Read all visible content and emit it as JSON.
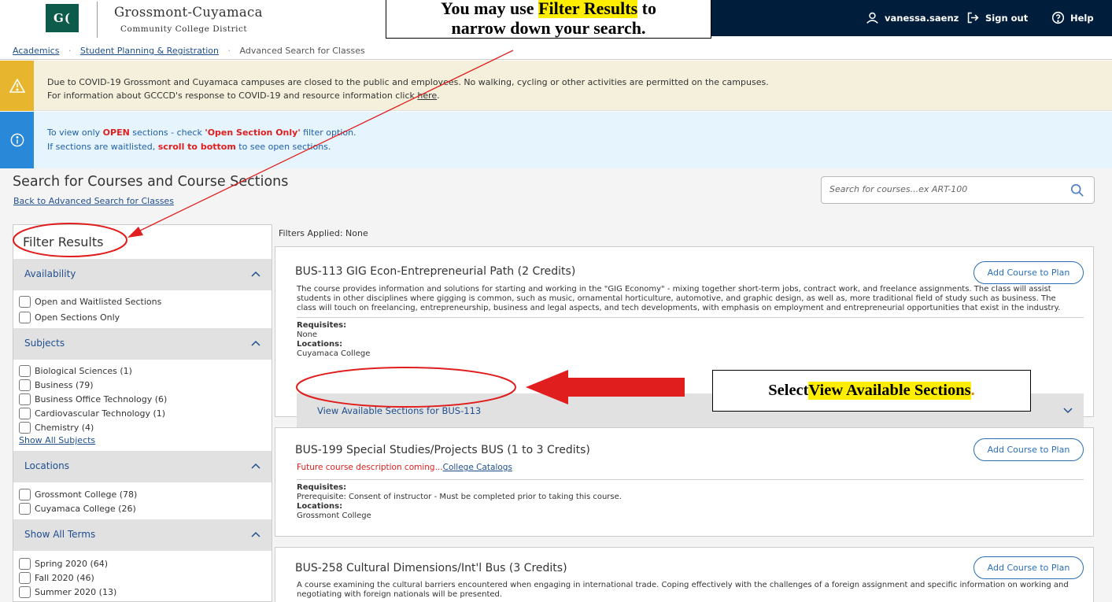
{
  "header": {
    "logo_mark": "G(",
    "logo_line1": "Grossmont-Cuyamaca",
    "logo_line2": "Community College District",
    "user": "vanessa.saenz",
    "sign_out": "Sign out",
    "help": "Help",
    "nav_color": "#001e3c"
  },
  "callout_top": {
    "line1_pre": "You may use ",
    "line1_hl": "Filter Results",
    "line1_post": " to",
    "line2": "narrow down your search."
  },
  "breadcrumbs": [
    "Academics",
    "Student Planning & Registration",
    "Advanced Search for Classes"
  ],
  "warning": {
    "line1": "Due to COVID-19 Grossmont and Cuyamaca campuses are closed to the public and employees. No walking, cycling or other activities are permitted on the campuses.",
    "line2_pre": "For information about GCCCD's response to COVID-19 and resource information click ",
    "line2_link": "here",
    "line2_post": ".",
    "accent": "#e8b52e"
  },
  "info": {
    "l1a": "To view only ",
    "l1b": "OPEN",
    "l1c": " sections - check ",
    "l1d": "'Open Section Only'",
    "l1e": " filter option.",
    "l2a": "If sections are waitlisted, ",
    "l2b": "scroll to bottom",
    "l2c": " to see open sections.",
    "accent": "#2a88d8"
  },
  "search": {
    "title": "Search for Courses and Course Sections",
    "back_link": "Back to Advanced Search for Classes",
    "placeholder": "Search for courses...ex ART-100"
  },
  "filter": {
    "title": "Filter Results",
    "availability": {
      "label": "Availability",
      "options": [
        "Open and Waitlisted Sections",
        "Open Sections Only"
      ]
    },
    "subjects": {
      "label": "Subjects",
      "options": [
        "Biological Sciences (1)",
        "Business (79)",
        "Business Office Technology (6)",
        "Cardiovascular Technology (1)",
        "Chemistry (4)"
      ],
      "show_all": "Show All Subjects"
    },
    "locations": {
      "label": "Locations",
      "options": [
        "Grossmont College (78)",
        "Cuyamaca College (26)"
      ]
    },
    "terms": {
      "label": "Show All Terms",
      "options": [
        "Spring 2020 (64)",
        "Fall 2020 (46)",
        "Summer 2020 (13)"
      ]
    }
  },
  "filters_applied": "Filters Applied: None",
  "courses": [
    {
      "title": "BUS-113 GIG Econ-Entrepreneurial Path (2 Credits)",
      "button": "Add Course to Plan",
      "description": "The course provides information and solutions for starting and working in the \"GIG Economy\" - mixing together short-term jobs, contract work, and freelance assignments. The class will assist students in other disciplines where gigging is common, such as music, ornamental horticulture, automotive, and graphic design, as well as, more traditional field of study such as business. The class will touch on freelancing, entrepreneurship, business and legal aspects, and tech developments, with emphasis on employment and entrepreneurial opportunities that exist in the industry.",
      "requisites_label": "Requisites:",
      "requisites": "None",
      "locations_label": "Locations:",
      "locations": "Cuyamaca College",
      "view_sections": "View Available Sections for BUS-113"
    },
    {
      "title": "BUS-199 Special Studies/Projects BUS (1 to 3 Credits)",
      "button": "Add Course to Plan",
      "future": "Future course description coming...",
      "catalog_link": "College Catalogs",
      "requisites_label": "Requisites:",
      "requisites": "Prerequisite: Consent of instructor - Must be completed prior to taking this course.",
      "locations_label": "Locations:",
      "locations": "Grossmont College"
    },
    {
      "title": "BUS-258 Cultural Dimensions/Int'l Bus (3 Credits)",
      "button": "Add Course to Plan",
      "description": "A course examining the cultural barriers encountered when engaging in international trade. Coping effectively with the challenges of a foreign assignment and specific information on working and negotiating with foreign nationals will be presented."
    }
  ],
  "callout_select": {
    "pre": "Select ",
    "hl": "View Available Sections",
    "post": "."
  },
  "annotation_color": "#e01e1e"
}
